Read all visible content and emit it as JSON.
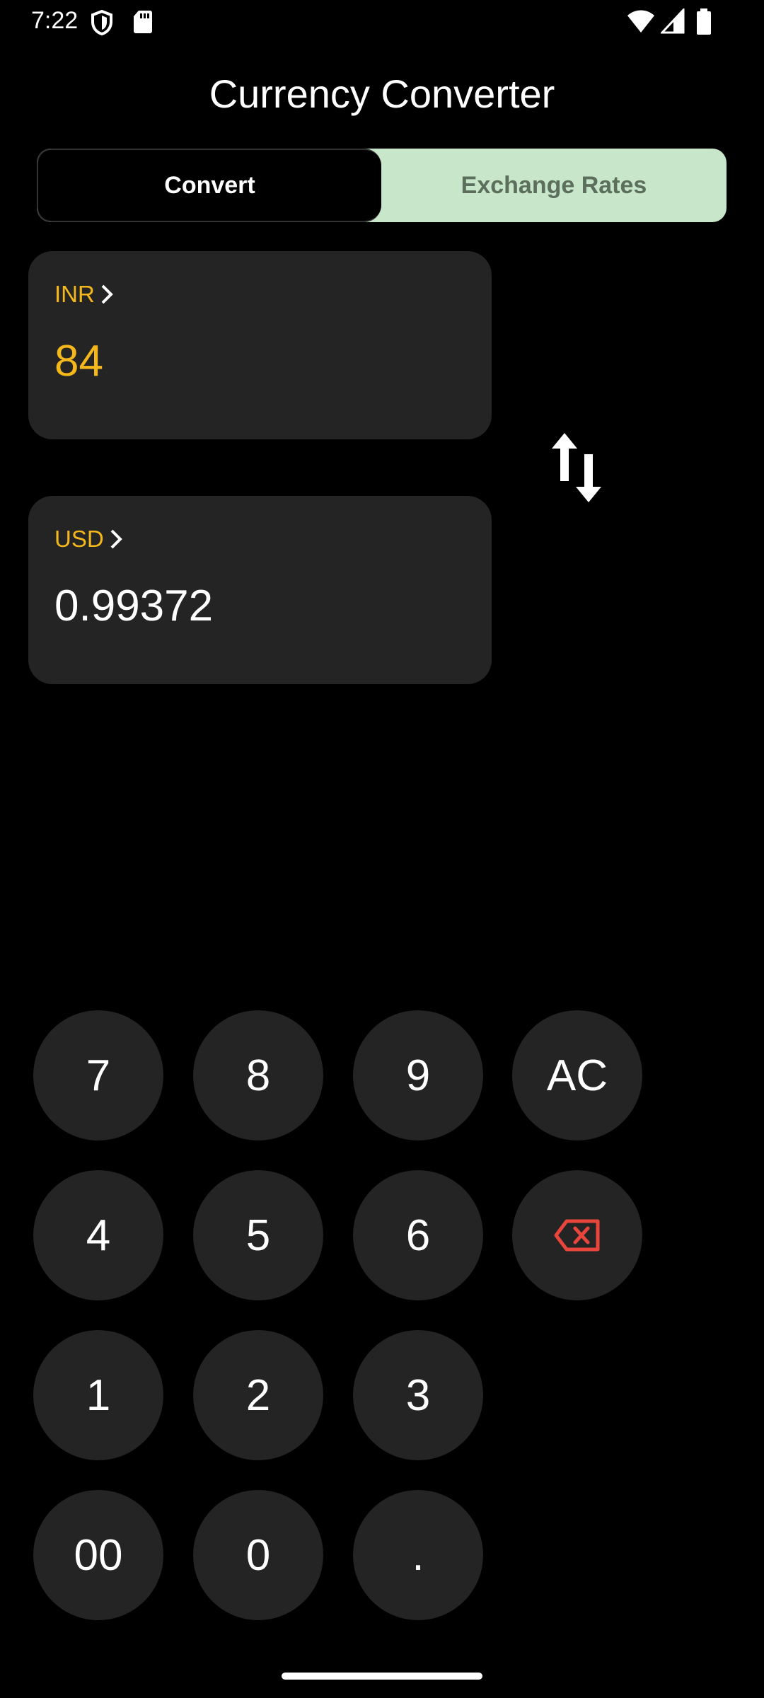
{
  "status_bar": {
    "time": "7:22",
    "icons": [
      "shield-icon",
      "sd-card-icon",
      "wifi-icon",
      "signal-icon",
      "battery-icon"
    ]
  },
  "app": {
    "title": "Currency Converter"
  },
  "tabs": [
    {
      "label": "Convert",
      "selected": true
    },
    {
      "label": "Exchange Rates",
      "selected": false
    }
  ],
  "from": {
    "code": "INR",
    "value": "84"
  },
  "to": {
    "code": "USD",
    "value": "0.99372"
  },
  "keypad": {
    "k7": "7",
    "k8": "8",
    "k9": "9",
    "clear": "AC",
    "k4": "4",
    "k5": "5",
    "k6": "6",
    "backspace_icon": "backspace-icon",
    "k1": "1",
    "k2": "2",
    "k3": "3",
    "k00": "00",
    "k0": "0",
    "dot": "."
  },
  "colors": {
    "accent": "#f5b81c",
    "tab_inactive_bg": "#c8e6c9",
    "key_bg": "#242424",
    "delete": "#e8453c"
  }
}
